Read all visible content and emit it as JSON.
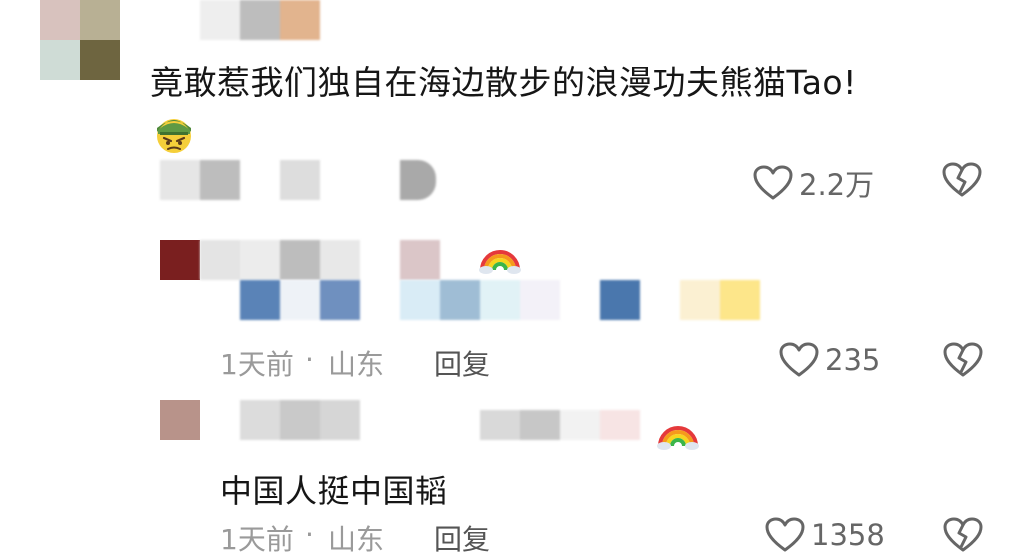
{
  "comments": [
    {
      "text": "竟敢惹我们独自在海边散步的浪漫功夫熊猫Tao!",
      "likes": "2.2万",
      "reaction_icon": "angry-face-emoji"
    }
  ],
  "replies": [
    {
      "time": "1天前",
      "separator": "·",
      "location": "山东",
      "reply_label": "回复",
      "likes": "235",
      "badge_icon": "rainbow-emoji"
    },
    {
      "text": "中国人挺中国韬",
      "time": "1天前",
      "separator": "·",
      "location": "山东",
      "reply_label": "回复",
      "likes": "1358",
      "badge_icon": "rainbow-emoji"
    }
  ],
  "colors": {
    "text": "#161616",
    "meta": "#9a9a9a",
    "reply": "#555555",
    "icon": "#666666"
  }
}
